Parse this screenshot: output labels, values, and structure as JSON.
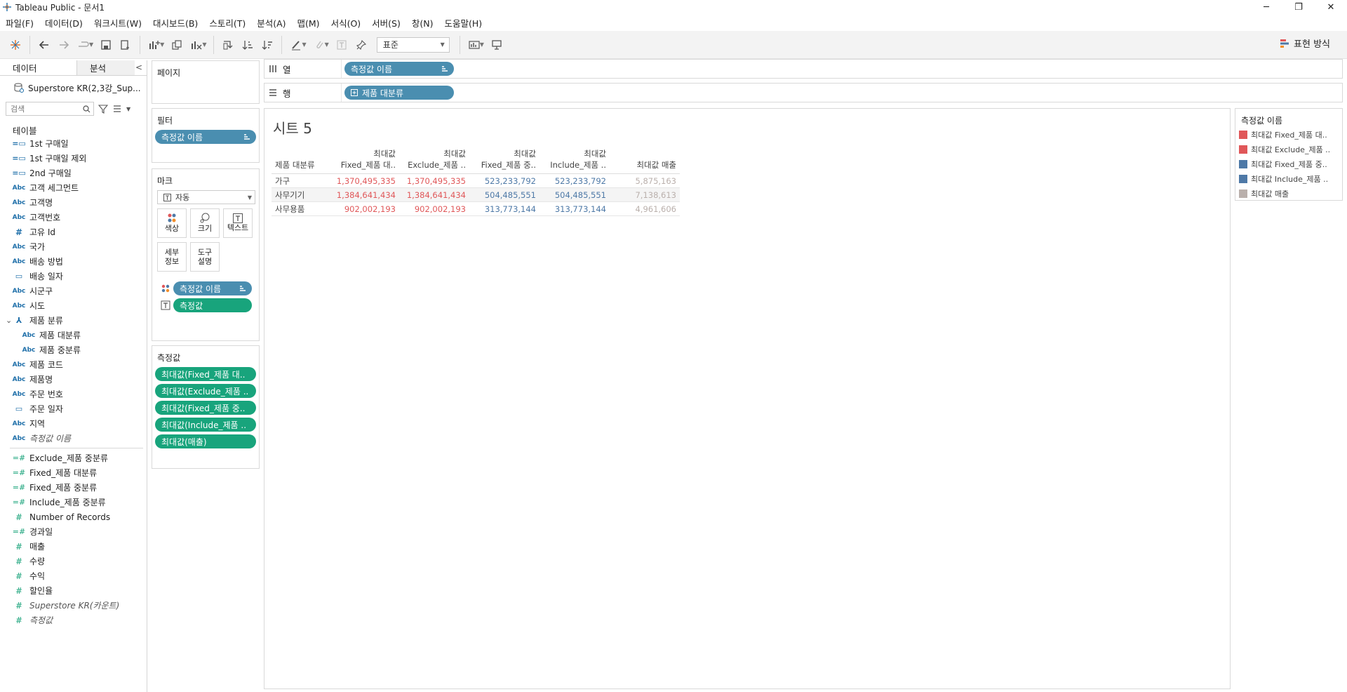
{
  "window": {
    "title": "Tableau Public - 문서1"
  },
  "menu": [
    "파일(F)",
    "데이터(D)",
    "워크시트(W)",
    "대시보드(B)",
    "스토리(T)",
    "분석(A)",
    "맵(M)",
    "서식(O)",
    "서버(S)",
    "창(N)",
    "도움말(H)"
  ],
  "toolbar": {
    "fit_select": "표준",
    "show_me_label": "표현 방식"
  },
  "data_pane": {
    "tabs": [
      "데이터",
      "분석"
    ],
    "datasource": "Superstore KR(2,3강_Sup...",
    "search_placeholder": "검색",
    "tables_header": "테이블",
    "fields": [
      {
        "label": "1st 구매일",
        "type": "date-calc"
      },
      {
        "label": "1st 구매일 제외",
        "type": "date-calc"
      },
      {
        "label": "2nd 구매일",
        "type": "date-calc"
      },
      {
        "label": "고객 세그먼트",
        "type": "abc"
      },
      {
        "label": "고객명",
        "type": "abc"
      },
      {
        "label": "고객번호",
        "type": "abc"
      },
      {
        "label": "고유 Id",
        "type": "num-dim"
      },
      {
        "label": "국가",
        "type": "abc"
      },
      {
        "label": "배송 방법",
        "type": "abc"
      },
      {
        "label": "배송 일자",
        "type": "date"
      },
      {
        "label": "시군구",
        "type": "abc"
      },
      {
        "label": "시도",
        "type": "abc"
      },
      {
        "label": "제품 분류",
        "type": "hier"
      },
      {
        "label": "제품 대분류",
        "type": "abc",
        "sub": true
      },
      {
        "label": "제품 중분류",
        "type": "abc",
        "sub": true
      },
      {
        "label": "제품 코드",
        "type": "abc"
      },
      {
        "label": "제품명",
        "type": "abc"
      },
      {
        "label": "주문 번호",
        "type": "abc"
      },
      {
        "label": "주문 일자",
        "type": "date"
      },
      {
        "label": "지역",
        "type": "abc"
      },
      {
        "label": "측정값 이름",
        "type": "abc",
        "italic": true
      }
    ],
    "measures": [
      {
        "label": "Exclude_제품 중분류",
        "type": "meas-calc"
      },
      {
        "label": "Fixed_제품 대분류",
        "type": "meas-calc"
      },
      {
        "label": "Fixed_제품 중분류",
        "type": "meas-calc"
      },
      {
        "label": "Include_제품 중분류",
        "type": "meas-calc"
      },
      {
        "label": "Number of Records",
        "type": "meas"
      },
      {
        "label": "경과일",
        "type": "meas-calc"
      },
      {
        "label": "매출",
        "type": "meas"
      },
      {
        "label": "수량",
        "type": "meas"
      },
      {
        "label": "수익",
        "type": "meas"
      },
      {
        "label": "할인율",
        "type": "meas"
      },
      {
        "label": "Superstore KR(카운트)",
        "type": "meas",
        "italic": true
      },
      {
        "label": "측정값",
        "type": "meas",
        "italic": true
      }
    ]
  },
  "pages": {
    "title": "페이지"
  },
  "filters": {
    "title": "필터",
    "pill": "측정값 이름"
  },
  "marks": {
    "title": "마크",
    "type": "자동",
    "buttons": [
      "색상",
      "크기",
      "텍스트",
      "세부\n정보",
      "도구\n설명"
    ],
    "pills": [
      "측정값 이름",
      "측정값"
    ]
  },
  "measure_values": {
    "title": "측정값",
    "pills": [
      "최대값(Fixed_제품 대..",
      "최대값(Exclude_제품 ..",
      "최대값(Fixed_제품 중..",
      "최대값(Include_제품 ..",
      "최대값(매출)"
    ]
  },
  "columns_shelf": {
    "label": "열",
    "pill": "측정값 이름"
  },
  "rows_shelf": {
    "label": "행",
    "pill": "제품 대분류"
  },
  "sheet": {
    "title": "시트 5",
    "row_header": "제품 대분류",
    "columns": [
      {
        "top": "최대값",
        "bottom": "Fixed_제품 대..",
        "color": "#e05759"
      },
      {
        "top": "최대값",
        "bottom": "Exclude_제품 ..",
        "color": "#e05759"
      },
      {
        "top": "최대값",
        "bottom": "Fixed_제품 중..",
        "color": "#4e79a7"
      },
      {
        "top": "최대값",
        "bottom": "Include_제품 ..",
        "color": "#4e79a7"
      },
      {
        "top": "",
        "bottom": "최대값 매출",
        "color": "#bab0ac"
      }
    ],
    "rows": [
      {
        "label": "가구",
        "values": [
          "1,370,495,335",
          "1,370,495,335",
          "523,233,792",
          "523,233,792",
          "5,875,163"
        ]
      },
      {
        "label": "사무기기",
        "values": [
          "1,384,641,434",
          "1,384,641,434",
          "504,485,551",
          "504,485,551",
          "7,138,613"
        ]
      },
      {
        "label": "사무용품",
        "values": [
          "902,002,193",
          "902,002,193",
          "313,773,144",
          "313,773,144",
          "4,961,606"
        ]
      }
    ]
  },
  "legend": {
    "title": "측정값 이름",
    "items": [
      {
        "label": "최대값 Fixed_제품 대..",
        "color": "#e05759"
      },
      {
        "label": "최대값 Exclude_제품 ..",
        "color": "#e05759"
      },
      {
        "label": "최대값 Fixed_제품 중..",
        "color": "#4e79a7"
      },
      {
        "label": "최대값 Include_제품 ..",
        "color": "#4e79a7"
      },
      {
        "label": "최대값 매출",
        "color": "#bab0ac"
      }
    ]
  }
}
